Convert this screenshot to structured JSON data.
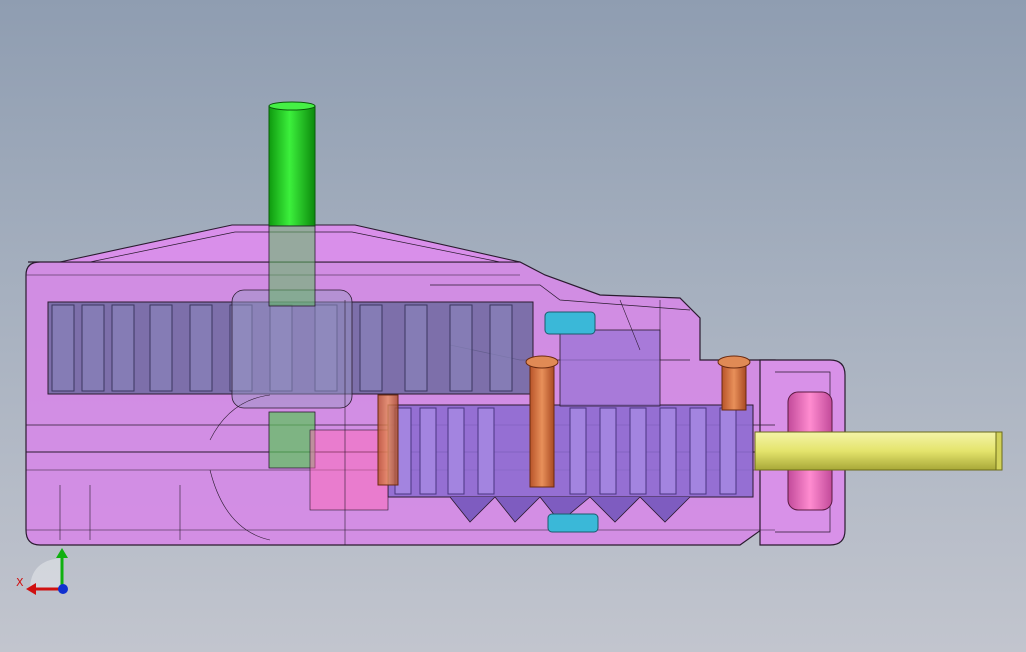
{
  "viewport": {
    "background_top": "#8f9db1",
    "background_bottom": "#c2c5ce"
  },
  "model": {
    "housing_color": "#d58ae6",
    "gear_color": "#8e6bd0",
    "input_shaft_color": "#1fd41f",
    "output_shaft_color": "#e6e67a",
    "bolt_color": "#d9773f",
    "bushing_color": "#3ab8d8",
    "flange_color": "#ff6ab8"
  },
  "triad": {
    "x_label": "X",
    "x_color": "#d01010",
    "y_color": "#10b010",
    "z_color": "#1030d0"
  }
}
